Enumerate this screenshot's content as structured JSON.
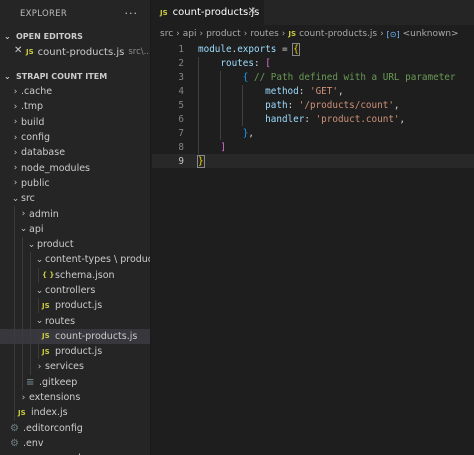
{
  "sidebar": {
    "title": "EXPLORER",
    "more": "···",
    "open_editors_header": "OPEN EDITORS",
    "open_editor": {
      "close": "✕",
      "badge": "JS",
      "name": "count-products.js",
      "path": "src\\..."
    },
    "project_header": "STRAPI COUNT ITEM"
  },
  "tree": [
    {
      "label": ".cache",
      "kind": "folder",
      "open": false,
      "depth": 0
    },
    {
      "label": ".tmp",
      "kind": "folder",
      "open": false,
      "depth": 0
    },
    {
      "label": "build",
      "kind": "folder",
      "open": false,
      "depth": 0
    },
    {
      "label": "config",
      "kind": "folder",
      "open": false,
      "depth": 0
    },
    {
      "label": "database",
      "kind": "folder",
      "open": false,
      "depth": 0
    },
    {
      "label": "node_modules",
      "kind": "folder",
      "open": false,
      "depth": 0
    },
    {
      "label": "public",
      "kind": "folder",
      "open": false,
      "depth": 0
    },
    {
      "label": "src",
      "kind": "folder",
      "open": true,
      "depth": 0
    },
    {
      "label": "admin",
      "kind": "folder",
      "open": false,
      "depth": 1
    },
    {
      "label": "api",
      "kind": "folder",
      "open": true,
      "depth": 1
    },
    {
      "label": "product",
      "kind": "folder",
      "open": true,
      "depth": 2
    },
    {
      "label": "content-types \\ product",
      "kind": "folder",
      "open": true,
      "depth": 3
    },
    {
      "label": "schema.json",
      "kind": "json",
      "depth": 4
    },
    {
      "label": "controllers",
      "kind": "folder",
      "open": true,
      "depth": 3
    },
    {
      "label": "product.js",
      "kind": "js",
      "depth": 4
    },
    {
      "label": "routes",
      "kind": "folder",
      "open": true,
      "depth": 3
    },
    {
      "label": "count-products.js",
      "kind": "js",
      "depth": 4,
      "selected": true
    },
    {
      "label": "product.js",
      "kind": "js",
      "depth": 4
    },
    {
      "label": "services",
      "kind": "folder",
      "open": false,
      "depth": 3
    },
    {
      "label": ".gitkeep",
      "kind": "file",
      "depth": 2
    },
    {
      "label": "extensions",
      "kind": "folder",
      "open": false,
      "depth": 1
    },
    {
      "label": "index.js",
      "kind": "js",
      "depth": 1
    },
    {
      "label": ".editorconfig",
      "kind": "gear",
      "depth": 0
    },
    {
      "label": ".env",
      "kind": "gear",
      "depth": 0
    },
    {
      "label": ".env.example",
      "kind": "file",
      "depth": 0
    }
  ],
  "icons": {
    "chevron_right": "›",
    "chevron_down": "⌄",
    "js": "JS",
    "json": "{ }",
    "gear": "⚙",
    "file": "≡"
  },
  "colors": {
    "js": "#cbcb41",
    "json": "#cbcb41",
    "gear": "#6d8086",
    "file": "#6d8086"
  },
  "editor": {
    "tab": {
      "badge": "JS",
      "label": "count-products.js",
      "close": "✕"
    },
    "breadcrumbs": [
      "src",
      "api",
      "product",
      "routes"
    ],
    "breadcrumb_file": "count-products.js",
    "breadcrumb_symbol": "<unknown>",
    "lines": [
      {
        "n": "1",
        "tokens": [
          [
            "kw",
            "module"
          ],
          [
            "plain",
            "."
          ],
          [
            "kw",
            "exports"
          ],
          [
            "plain",
            " = "
          ],
          [
            "b1hl",
            "{"
          ]
        ]
      },
      {
        "n": "2",
        "tokens": [
          [
            "plain",
            "    "
          ],
          [
            "prop",
            "routes"
          ],
          [
            "plain",
            ": "
          ],
          [
            "b2",
            "["
          ]
        ]
      },
      {
        "n": "3",
        "tokens": [
          [
            "plain",
            "        "
          ],
          [
            "b3",
            "{"
          ],
          [
            "plain",
            " "
          ],
          [
            "com",
            "// Path defined with a URL parameter"
          ]
        ]
      },
      {
        "n": "4",
        "tokens": [
          [
            "plain",
            "            "
          ],
          [
            "prop",
            "method"
          ],
          [
            "plain",
            ": "
          ],
          [
            "str",
            "'GET'"
          ],
          [
            "plain",
            ","
          ]
        ]
      },
      {
        "n": "5",
        "tokens": [
          [
            "plain",
            "            "
          ],
          [
            "prop",
            "path"
          ],
          [
            "plain",
            ": "
          ],
          [
            "str",
            "'/products/count'"
          ],
          [
            "plain",
            ","
          ]
        ]
      },
      {
        "n": "6",
        "tokens": [
          [
            "plain",
            "            "
          ],
          [
            "prop",
            "handler"
          ],
          [
            "plain",
            ": "
          ],
          [
            "str",
            "'product.count'"
          ],
          [
            "plain",
            ","
          ]
        ]
      },
      {
        "n": "7",
        "tokens": [
          [
            "plain",
            "        "
          ],
          [
            "b3",
            "}"
          ],
          [
            "plain",
            ","
          ]
        ]
      },
      {
        "n": "8",
        "tokens": [
          [
            "plain",
            "    "
          ],
          [
            "b2",
            "]"
          ]
        ]
      },
      {
        "n": "9",
        "tokens": [
          [
            "b1hl",
            "}"
          ]
        ]
      }
    ]
  }
}
